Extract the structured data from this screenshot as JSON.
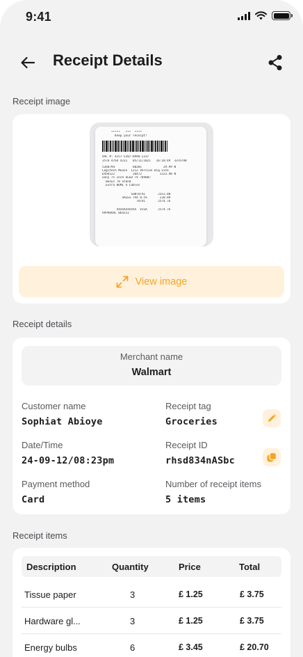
{
  "status_bar": {
    "time": "9:41"
  },
  "header": {
    "title": "Receipt Details"
  },
  "sections": {
    "receipt_image": "Receipt image",
    "receipt_details": "Receipt details",
    "receipt_items": "Receipt items"
  },
  "receipt_preview": {
    "lines": [
      "     *****   ***  ****",
      "       Keep your receipt!",
      "VAL #: 4257-5207-8948-2337",
      "3576 4764 4231   05/11/2021   16:10:49  3376798",
      "5268794          60201            29.99 N",
      "Logitech Mouse  1212 Version Big Size",
      "6456522          26472          2323.90 N",
      "Sony 75 Inch OLED TV 789087",
      "  Bonus TV Stand",
      "  Extra HDMI 4 Cables",
      "                SUBTOTAL       2353.80",
      "           SALES TAX 8.5%       220.89",
      "                   TOTAL       2574.76",
      "        XXXXXXXXXXX  VISA      2574.76",
      "APPROVAL 064152"
    ]
  },
  "view_image_button": {
    "label": "View image"
  },
  "details": {
    "merchant_label": "Merchant name",
    "merchant_value": "Walmart",
    "customer_label": "Customer name",
    "customer_value": "Sophiat Abioye",
    "tag_label": "Receipt tag",
    "tag_value": "Groceries",
    "date_label": "Date/Time",
    "date_value": "24-09-12/08:23pm",
    "id_label": "Receipt ID",
    "id_value": "rhsd834nASbc",
    "payment_label": "Payment method",
    "payment_value": "Card",
    "count_label": "Number of receipt items",
    "count_value": "5 items"
  },
  "items_table": {
    "headers": {
      "description": "Description",
      "quantity": "Quantity",
      "price": "Price",
      "total": "Total"
    },
    "rows": [
      {
        "description": "Tissue paper",
        "quantity": "3",
        "price": "£ 1.25",
        "total": "£ 3.75"
      },
      {
        "description": "Hardware gl...",
        "quantity": "3",
        "price": "£ 1.25",
        "total": "£ 3.75"
      },
      {
        "description": "Energy bulbs",
        "quantity": "6",
        "price": "£ 3.45",
        "total": "£ 20.70"
      }
    ]
  },
  "colors": {
    "accent": "#f5a524",
    "accent_soft": "#fff1dc",
    "background": "#f2f2f3",
    "card": "#ffffff"
  },
  "icons": [
    "back-arrow-icon",
    "share-icon",
    "expand-icon",
    "pencil-icon",
    "copy-icon"
  ]
}
